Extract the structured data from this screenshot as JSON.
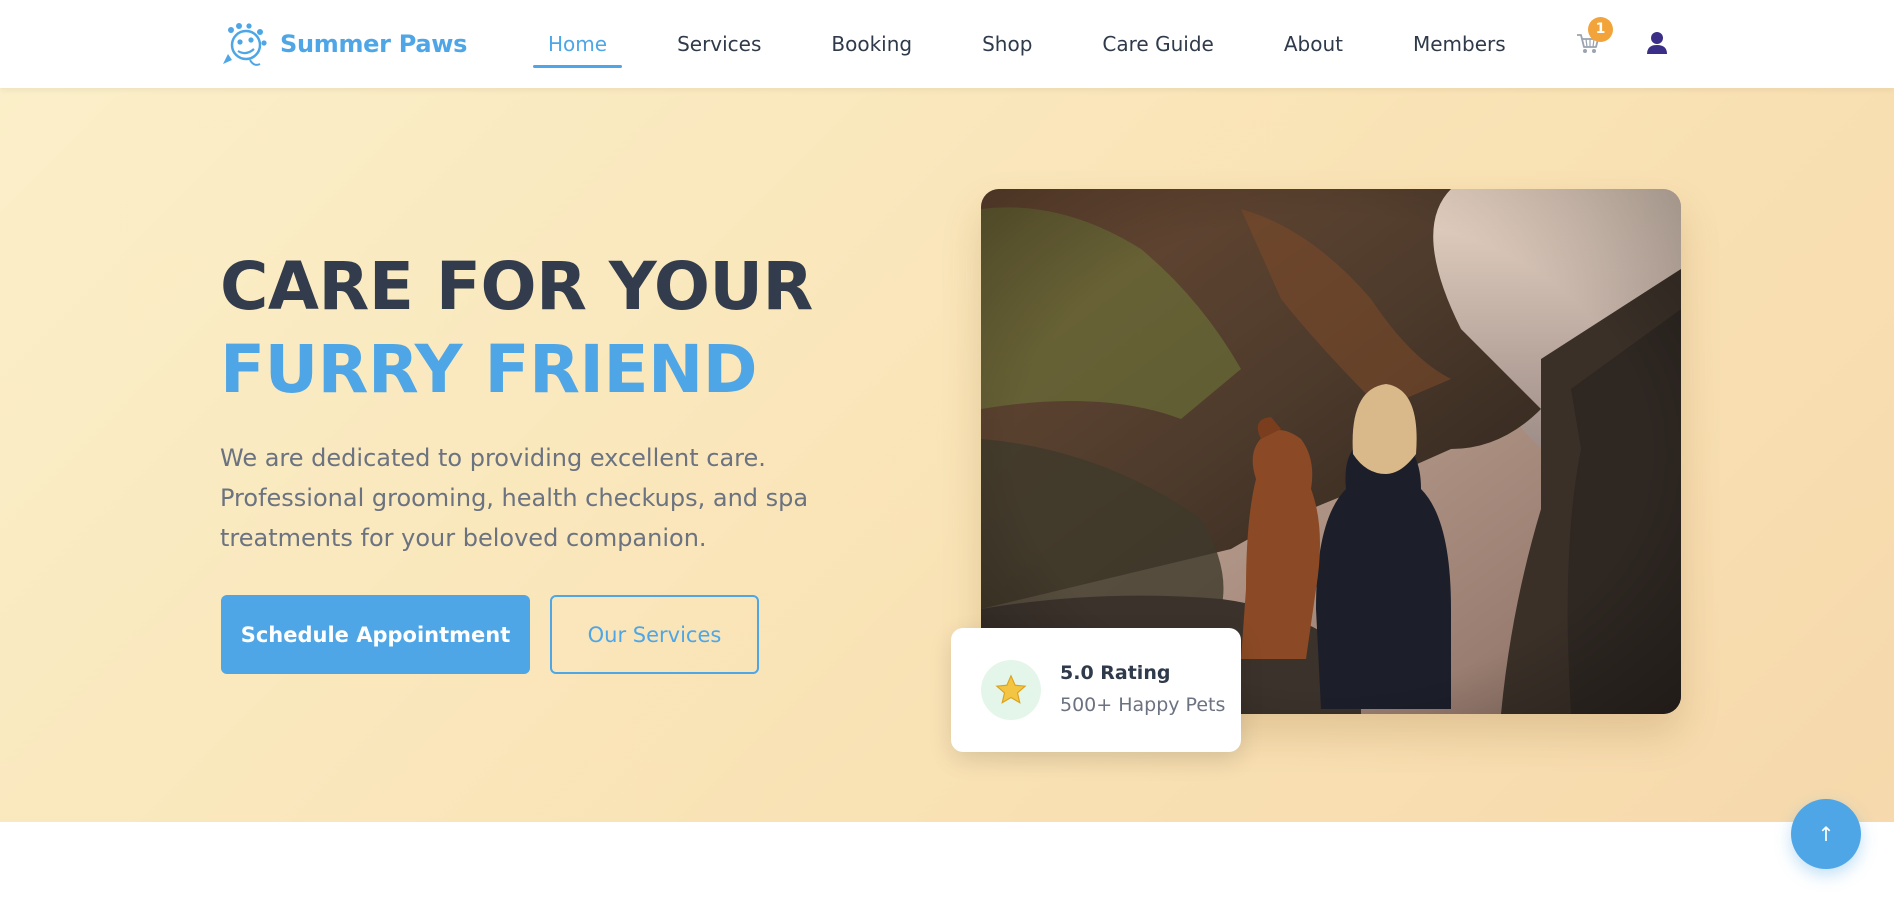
{
  "brand": {
    "name": "Summer Paws",
    "logo_icon": "paw-logo-icon",
    "color": "#4ea6e6"
  },
  "nav": {
    "items": [
      {
        "label": "Home",
        "active": true
      },
      {
        "label": "Services"
      },
      {
        "label": "Booking"
      },
      {
        "label": "Shop"
      },
      {
        "label": "Care Guide"
      },
      {
        "label": "About"
      },
      {
        "label": "Members"
      }
    ]
  },
  "header_actions": {
    "cart_icon": "cart-icon",
    "cart_count": "1",
    "user_icon": "user-icon"
  },
  "hero": {
    "title_line1": "CARE FOR YOUR",
    "title_line2": "FURRY FRIEND",
    "description": "We are dedicated to providing excellent care. Professional grooming, health checkups, and spa treatments for your beloved companion.",
    "primary_button": "Schedule Appointment",
    "secondary_button": "Our Services",
    "image_alt": "photo-dog-and-woman-on-cliff"
  },
  "rating": {
    "icon": "star-icon",
    "title": "5.0 Rating",
    "subtitle": "500+ Happy Pets"
  },
  "back_to_top": {
    "label": "↑",
    "icon": "arrow-up-icon"
  },
  "colors": {
    "accent": "#4ea6e6",
    "heading": "#323c4c",
    "text_muted": "#6b7280",
    "badge": "#f2a43a",
    "hero_bg": "#f9e2b4"
  }
}
